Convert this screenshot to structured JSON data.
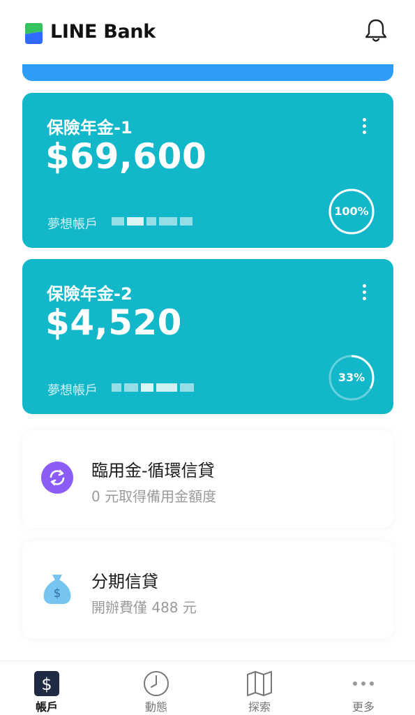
{
  "header": {
    "logo_text": "LINE Bank",
    "brand_colors": {
      "green": "#35c25f",
      "blue": "#2f6bff"
    },
    "bell_icon": "bell-icon"
  },
  "cards": [
    {
      "title": "保險年金-1",
      "amount": "$69,600",
      "account_label": "夢想帳戶",
      "progress_label": "100%",
      "progress_fraction": 1.0,
      "menu_icon": "kebab-icon"
    },
    {
      "title": "保險年金-2",
      "amount": "$4,520",
      "account_label": "夢想帳戶",
      "progress_label": "33%",
      "progress_fraction": 0.33,
      "menu_icon": "kebab-icon"
    }
  ],
  "card_color": "#12b8c9",
  "loans": [
    {
      "title": "臨用金-循環信貸",
      "subtitle": "0 元取得備用金額度",
      "icon": "revolving-arrows-icon",
      "icon_color": "#8b5cf6"
    },
    {
      "title": "分期信貸",
      "subtitle": "開辦費僅 488 元",
      "icon": "money-bag-icon",
      "icon_color": "#76c4f0"
    }
  ],
  "bottom_nav": {
    "items": [
      {
        "label": "帳戶",
        "icon": "dollar-icon",
        "active": true
      },
      {
        "label": "動態",
        "icon": "clock-icon",
        "active": false
      },
      {
        "label": "探索",
        "icon": "map-icon",
        "active": false
      },
      {
        "label": "更多",
        "icon": "more-icon",
        "active": false
      }
    ]
  }
}
